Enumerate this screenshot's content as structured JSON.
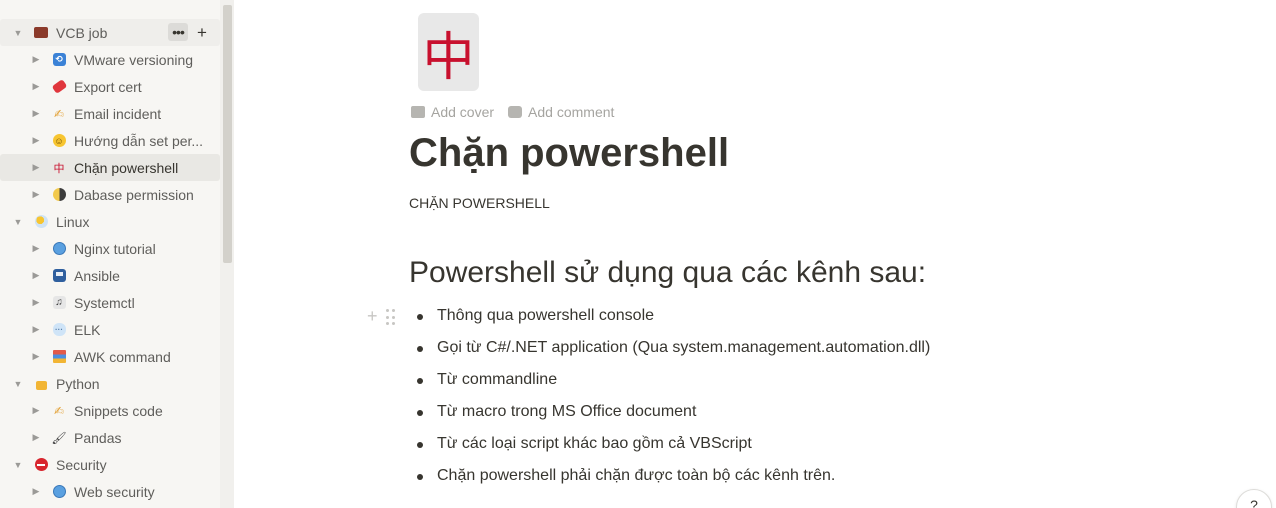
{
  "sidebar": {
    "items": [
      {
        "label": "VCB job",
        "arrow": "▼",
        "icon": "briefcase-icon"
      },
      {
        "label": "VMware versioning",
        "arrow": "▶",
        "icon": "refresh-icon"
      },
      {
        "label": "Export cert",
        "arrow": "▶",
        "icon": "ticket-icon"
      },
      {
        "label": "Email incident",
        "arrow": "▶",
        "icon": "writing-hand-icon"
      },
      {
        "label": "Hướng dẫn set per...",
        "arrow": "▶",
        "icon": "smiley-icon"
      },
      {
        "label": "Chặn powershell",
        "arrow": "▶",
        "icon": "mahjong-red-dragon-icon",
        "glyph": "中"
      },
      {
        "label": "Dabase permission",
        "arrow": "▶",
        "icon": "moon-icon"
      },
      {
        "label": "Linux",
        "arrow": "▼",
        "icon": "sun-cloud-icon"
      },
      {
        "label": "Nginx tutorial",
        "arrow": "▶",
        "icon": "globe-icon"
      },
      {
        "label": "Ansible",
        "arrow": "▶",
        "icon": "floppy-icon"
      },
      {
        "label": "Systemctl",
        "arrow": "▶",
        "icon": "music-score-icon"
      },
      {
        "label": "ELK",
        "arrow": "▶",
        "icon": "speech-bubble-icon"
      },
      {
        "label": "AWK command",
        "arrow": "▶",
        "icon": "books-icon"
      },
      {
        "label": "Python",
        "arrow": "▼",
        "icon": "lock-icon"
      },
      {
        "label": "Snippets code",
        "arrow": "▶",
        "icon": "writing-hand-icon"
      },
      {
        "label": "Pandas",
        "arrow": "▶",
        "icon": "paintbrush-icon"
      },
      {
        "label": "Security",
        "arrow": "▼",
        "icon": "no-entry-icon"
      },
      {
        "label": "Web security",
        "arrow": "▶",
        "icon": "globe-icon"
      }
    ],
    "more_glyph": "•••",
    "add_glyph": "+"
  },
  "page": {
    "icon_glyph": "中",
    "add_cover": "Add cover",
    "add_comment": "Add comment",
    "title": "Chặn powershell",
    "subtitle": "CHẶN POWERSHELL",
    "heading": "Powershell sử dụng qua các kênh sau:",
    "bullets": [
      "Thông qua powershell console",
      "Gọi từ C#/.NET application (Qua system.management.automation.dll)",
      "Từ commandline",
      "Từ macro trong MS Office document",
      "Từ các loại script khác bao gồm cả VBScript",
      "Chặn powershell phải chặn được toàn bộ các kênh trên."
    ],
    "block_add_glyph": "+"
  },
  "help_glyph": "?",
  "colors": {
    "sidebar_bg": "#f7f6f3",
    "active_row": "#e9e8e4",
    "text": "#37352f",
    "muted": "#a5a4a0",
    "dragon_red": "#c8102e"
  }
}
